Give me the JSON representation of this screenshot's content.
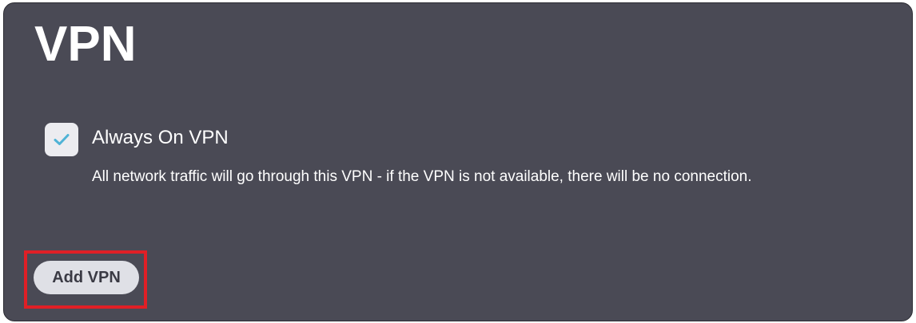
{
  "page": {
    "title": "VPN"
  },
  "always_on": {
    "checked": true,
    "label": "Always On VPN",
    "description": "All network traffic will go through this VPN - if the VPN is not available, there will be no connection.",
    "check_icon": "check-icon",
    "check_color": "#4fb3d6"
  },
  "actions": {
    "add_vpn_label": "Add VPN"
  },
  "highlight_color": "#e01f26"
}
